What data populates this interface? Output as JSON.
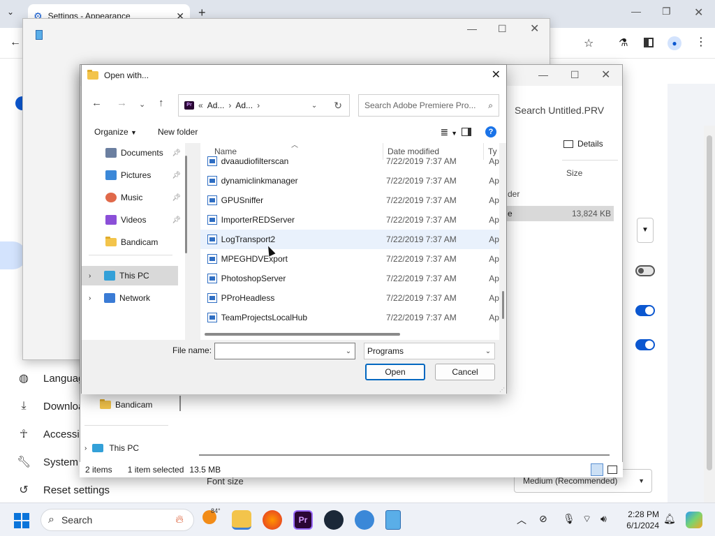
{
  "browser": {
    "tab_title": "Settings - Appearance",
    "settings_nav": [
      "Languages",
      "Downloads",
      "Accessibility",
      "System",
      "Reset settings"
    ],
    "font_size_label": "Font size",
    "font_size_value": "Medium (Recommended)"
  },
  "explorer": {
    "search_placeholder": "Search Untitled.PRV",
    "details_label": "Details",
    "size_header": "Size",
    "row_label_folder": "der",
    "row_label_file": "e",
    "row_size": "13,824 KB",
    "nav_bandicam": "Bandicam",
    "nav_this_pc": "This PC",
    "status_items": "2 items",
    "status_selected": "1 item selected",
    "status_size": "13.5 MB"
  },
  "dialog": {
    "title": "Open with...",
    "breadcrumb": [
      "Ad...",
      "Ad..."
    ],
    "search_placeholder": "Search Adobe Premiere Pro...",
    "organize_label": "Organize",
    "new_folder_label": "New folder",
    "nav_items": [
      {
        "label": "Documents",
        "pinned": true,
        "color": "#6b7fa0"
      },
      {
        "label": "Pictures",
        "pinned": true,
        "color": "#3b88d8"
      },
      {
        "label": "Music",
        "pinned": true,
        "color": "#e0694a"
      },
      {
        "label": "Videos",
        "pinned": true,
        "color": "#8b4fd8"
      },
      {
        "label": "Bandicam",
        "pinned": false,
        "color": "#f3c44b"
      }
    ],
    "tree_items": [
      "This PC",
      "Network"
    ],
    "columns": {
      "name": "Name",
      "date": "Date modified",
      "type": "Ty"
    },
    "files": [
      {
        "name": "dvaaudiofilterscan",
        "date": "7/22/2019 7:37 AM",
        "type": "Ap"
      },
      {
        "name": "dynamiclinkmanager",
        "date": "7/22/2019 7:37 AM",
        "type": "Ap"
      },
      {
        "name": "GPUSniffer",
        "date": "7/22/2019 7:37 AM",
        "type": "Ap"
      },
      {
        "name": "ImporterREDServer",
        "date": "7/22/2019 7:37 AM",
        "type": "Ap"
      },
      {
        "name": "LogTransport2",
        "date": "7/22/2019 7:37 AM",
        "type": "Ap"
      },
      {
        "name": "MPEGHDVExport",
        "date": "7/22/2019 7:37 AM",
        "type": "Ap"
      },
      {
        "name": "PhotoshopServer",
        "date": "7/22/2019 7:37 AM",
        "type": "Ap"
      },
      {
        "name": "PProHeadless",
        "date": "7/22/2019 7:37 AM",
        "type": "Ap"
      },
      {
        "name": "TeamProjectsLocalHub",
        "date": "7/22/2019 7:37 AM",
        "type": "Ap"
      }
    ],
    "file_name_label": "File name:",
    "file_name_value": "",
    "file_type_value": "Programs",
    "open_label": "Open",
    "cancel_label": "Cancel"
  },
  "taskbar": {
    "search_label": "Search",
    "weather": "84°",
    "time": "2:28 PM",
    "date": "6/1/2024"
  }
}
